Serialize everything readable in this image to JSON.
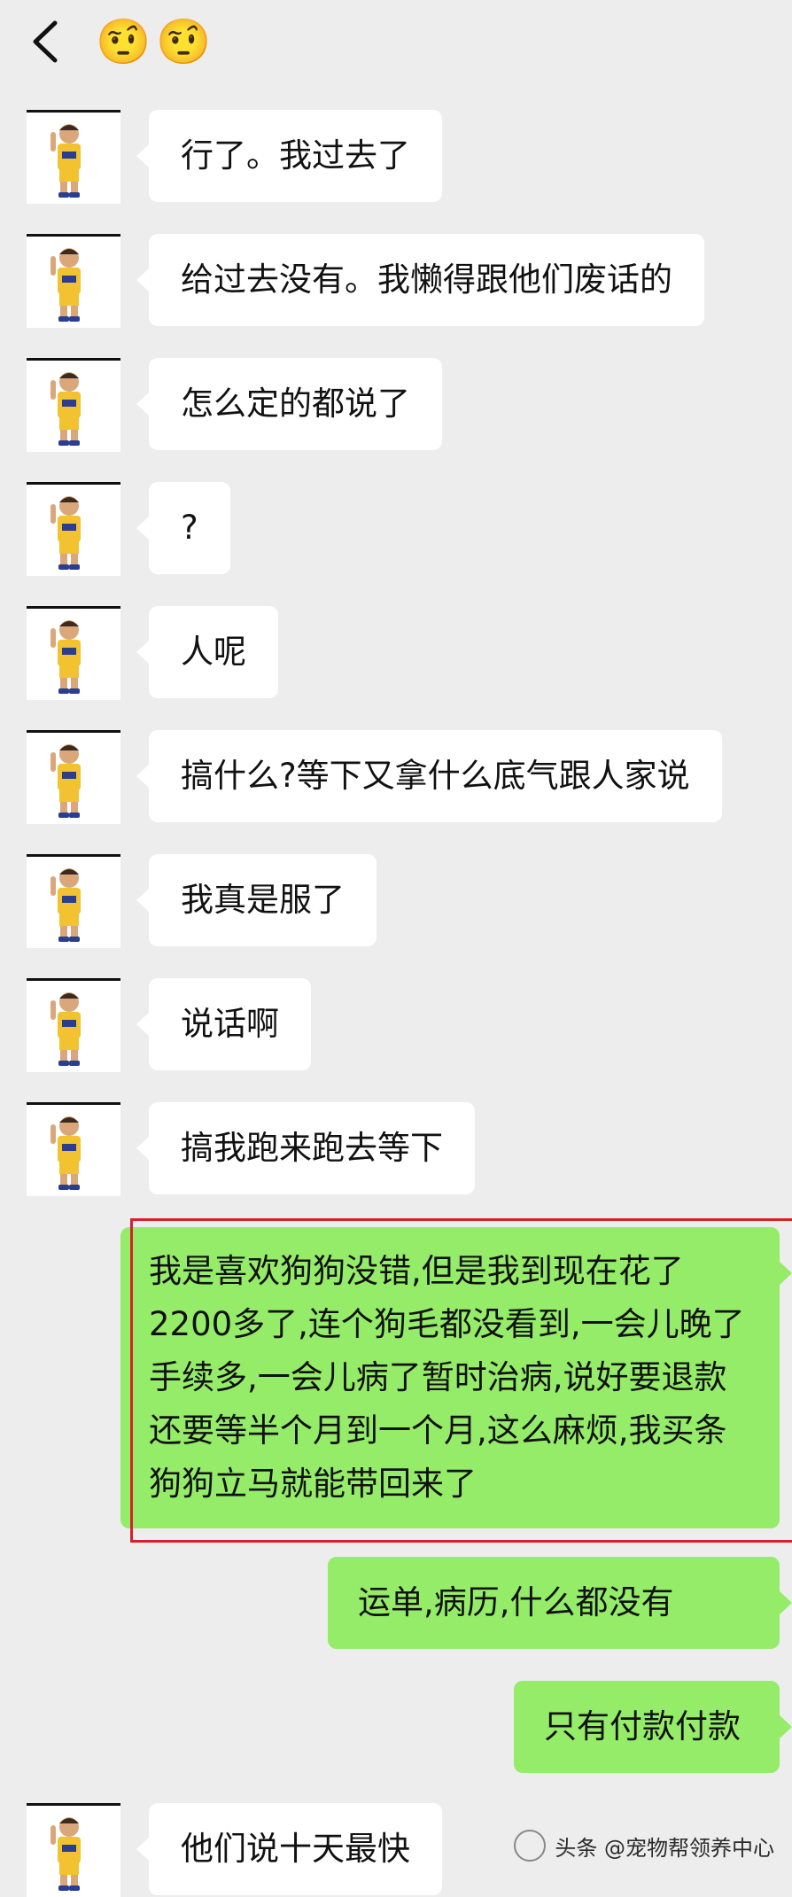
{
  "header": {
    "back_icon": "chevron-left-icon",
    "title_emoji": [
      "🤨",
      "🤨"
    ]
  },
  "messages": [
    {
      "side": "in",
      "text": "行了。我过去了"
    },
    {
      "side": "in",
      "text": "给过去没有。我懒得跟他们废话的"
    },
    {
      "side": "in",
      "text": "怎么定的都说了"
    },
    {
      "side": "in",
      "text": "?"
    },
    {
      "side": "in",
      "text": "人呢"
    },
    {
      "side": "in",
      "text": "搞什么?等下又拿什么底气跟人家说"
    },
    {
      "side": "in",
      "text": "我真是服了"
    },
    {
      "side": "in",
      "text": "说话啊"
    },
    {
      "side": "in",
      "text": "搞我跑来跑去等下"
    },
    {
      "side": "out",
      "text": "我是喜欢狗狗没错,但是我到现在花了2200多了,连个狗毛都没看到,一会儿晚了手续多,一会儿病了暂时治病,说好要退款还要等半个月到一个月,这么麻烦,我买条狗狗立马就能带回来了"
    },
    {
      "side": "out",
      "text": "运单,病历,什么都没有"
    },
    {
      "side": "out",
      "text": "只有付款付款"
    },
    {
      "side": "in",
      "text": "他们说十天最快"
    }
  ],
  "watermark": {
    "text": "头条 @宠物帮领养中心"
  },
  "colors": {
    "background": "#ededed",
    "incoming": "#ffffff",
    "outgoing": "#95ec69",
    "highlight": "#d8202a"
  }
}
